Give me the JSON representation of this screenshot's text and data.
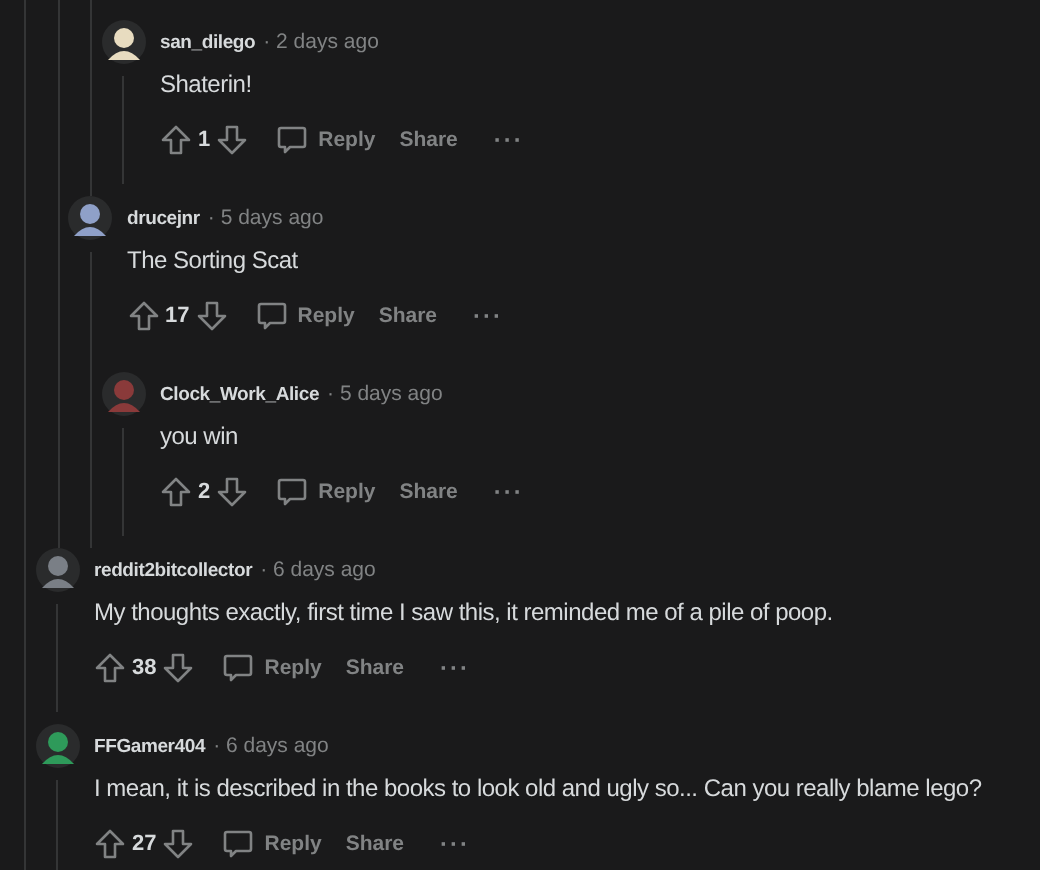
{
  "comments": [
    {
      "kind": "continuation",
      "children": [
        {
          "kind": "continuation",
          "children": [
            {
              "kind": "comment",
              "user": "san_dilego",
              "time": "· 2 days ago",
              "body": "Shaterin!",
              "score": "1",
              "reply": "Reply",
              "share": "Share",
              "more": "···",
              "color": "#e8dcc0"
            }
          ]
        },
        {
          "kind": "comment",
          "user": "drucejnr",
          "time": "· 5 days ago",
          "body": "The Sorting Scat",
          "score": "17",
          "reply": "Reply",
          "share": "Share",
          "more": "···",
          "color": "#8fa0c8",
          "children": [
            {
              "kind": "comment",
              "user": "Clock_Work_Alice",
              "time": "· 5 days ago",
              "body": "you win",
              "score": "2",
              "reply": "Reply",
              "share": "Share",
              "more": "···",
              "color": "#8a3a3a"
            }
          ]
        }
      ]
    },
    {
      "kind": "comment",
      "user": "reddit2bitcollector",
      "time": "· 6 days ago",
      "body": "My thoughts exactly, first time I saw this, it reminded me of a pile of poop.",
      "score": "38",
      "reply": "Reply",
      "share": "Share",
      "more": "···",
      "color": "#7a7f86"
    },
    {
      "kind": "comment",
      "user": "FFGamer404",
      "time": "· 6 days ago",
      "body": "I mean, it is described in the books to look old and ugly so... Can you really blame lego?",
      "score": "27",
      "reply": "Reply",
      "share": "Share",
      "more": "···",
      "color": "#2e9a5a"
    }
  ]
}
